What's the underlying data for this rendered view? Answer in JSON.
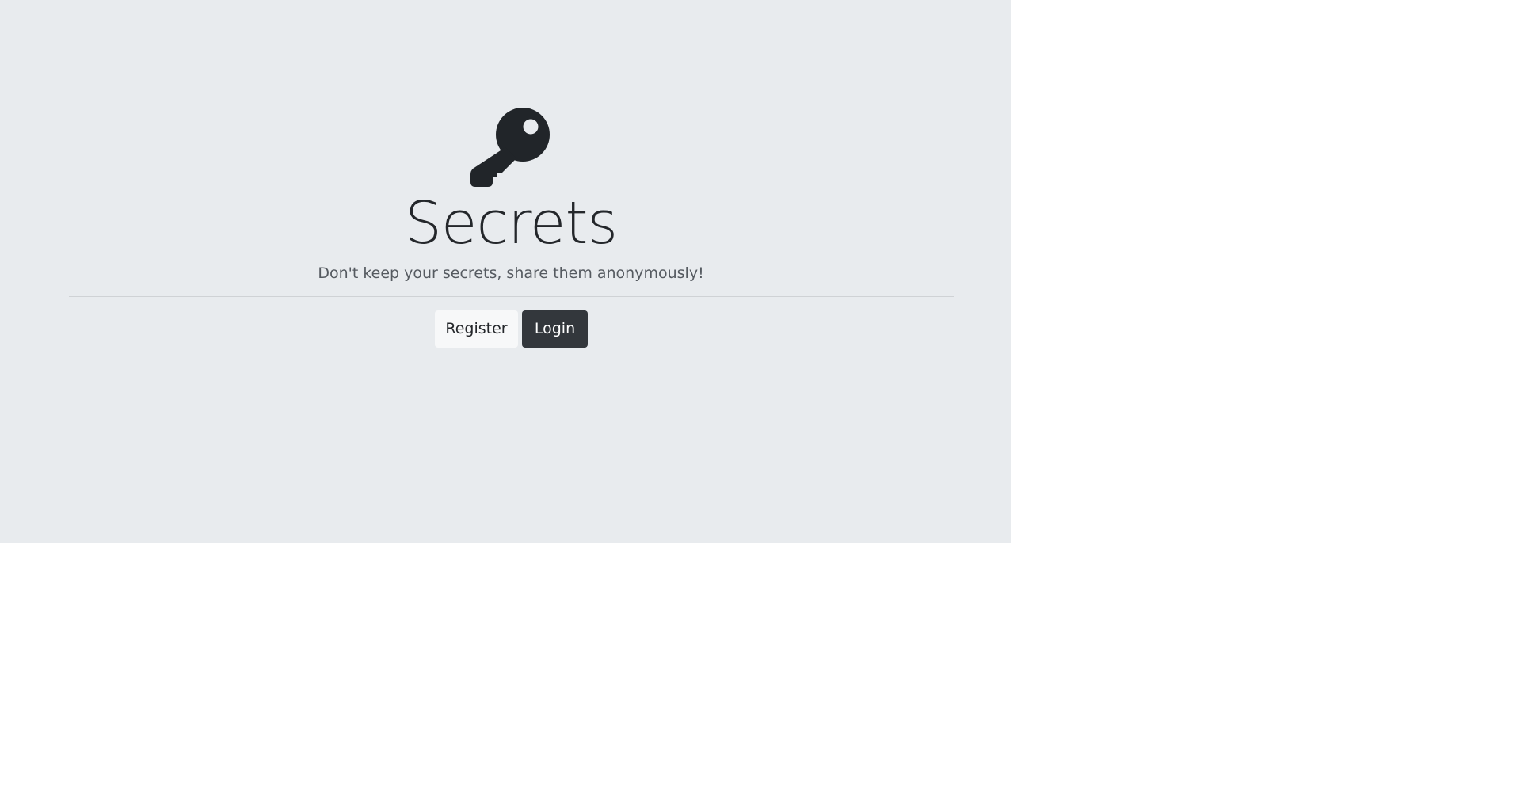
{
  "page": {
    "background": "#ffffff",
    "panel_background": "#e8ebee"
  },
  "hero": {
    "icon": "key-icon",
    "title": "Secrets",
    "subtitle": "Don't keep your secrets, share them anonymously!"
  },
  "actions": {
    "register_label": "Register",
    "login_label": "Login",
    "register_color": "#f7f8f9",
    "login_color": "#33373c"
  }
}
